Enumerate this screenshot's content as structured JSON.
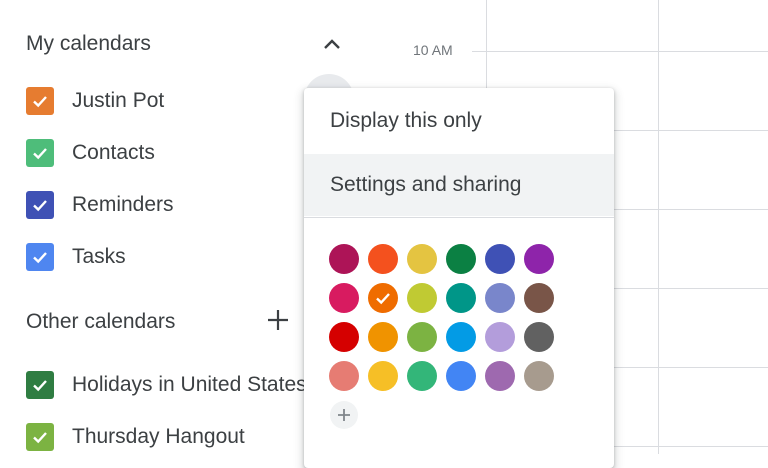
{
  "sidebar": {
    "my_calendars": {
      "title": "My calendars",
      "items": [
        {
          "label": "Justin Pot",
          "color": "#e67c30"
        },
        {
          "label": "Contacts",
          "color": "#4ebd7a"
        },
        {
          "label": "Reminders",
          "color": "#3f51b5"
        },
        {
          "label": "Tasks",
          "color": "#4f86f0"
        }
      ]
    },
    "other_calendars": {
      "title": "Other calendars",
      "items": [
        {
          "label": "Holidays in United States",
          "color": "#2f7d42"
        },
        {
          "label": "Thursday Hangout",
          "color": "#7cb342"
        }
      ]
    }
  },
  "grid": {
    "time_label": "10 AM"
  },
  "menu": {
    "items": [
      {
        "label": "Display this only"
      },
      {
        "label": "Settings and sharing"
      }
    ],
    "selected_color": "#e67c30",
    "colors": [
      [
        "#ad1457",
        "#f4511e",
        "#e4c441",
        "#0b8043",
        "#3f51b5",
        "#8e24aa"
      ],
      [
        "#d81b60",
        "#ef6c00",
        "#c0ca33",
        "#009688",
        "#7986cb",
        "#795548"
      ],
      [
        "#d50000",
        "#f09300",
        "#7cb342",
        "#039be5",
        "#b39ddb",
        "#616161"
      ],
      [
        "#e67c73",
        "#f6bf26",
        "#33b679",
        "#4285f4",
        "#9e69af",
        "#a79b8e"
      ]
    ]
  }
}
